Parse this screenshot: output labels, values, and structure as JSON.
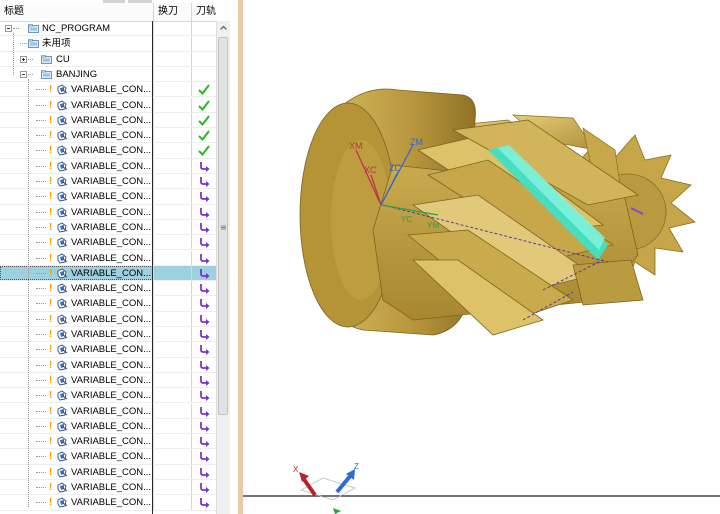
{
  "navigator": {
    "columns": {
      "name": "标题",
      "tool_change": "换刀",
      "toolpath": "刀轨"
    },
    "root": {
      "label": "NC_PROGRAM"
    },
    "unused": {
      "label": "未用项"
    },
    "groups": [
      {
        "label": "CU",
        "expanded": false
      },
      {
        "label": "BANJING",
        "expanded": true
      }
    ],
    "operations": [
      {
        "label": "VARIABLE_CON...",
        "status": "check"
      },
      {
        "label": "VARIABLE_CON...",
        "status": "check"
      },
      {
        "label": "VARIABLE_CON...",
        "status": "check"
      },
      {
        "label": "VARIABLE_CON...",
        "status": "check"
      },
      {
        "label": "VARIABLE_CON...",
        "status": "check"
      },
      {
        "label": "VARIABLE_CON...",
        "status": "regen"
      },
      {
        "label": "VARIABLE_CON...",
        "status": "regen"
      },
      {
        "label": "VARIABLE_CON...",
        "status": "regen"
      },
      {
        "label": "VARIABLE_CON...",
        "status": "regen"
      },
      {
        "label": "VARIABLE_CON...",
        "status": "regen"
      },
      {
        "label": "VARIABLE_CON...",
        "status": "regen"
      },
      {
        "label": "VARIABLE_CON...",
        "status": "regen"
      },
      {
        "label": "VARIABLE_CON...",
        "status": "regen",
        "selected": true
      },
      {
        "label": "VARIABLE_CON...",
        "status": "regen"
      },
      {
        "label": "VARIABLE_CON...",
        "status": "regen"
      },
      {
        "label": "VARIABLE_CON...",
        "status": "regen"
      },
      {
        "label": "VARIABLE_CON...",
        "status": "regen"
      },
      {
        "label": "VARIABLE_CON...",
        "status": "regen"
      },
      {
        "label": "VARIABLE_CON...",
        "status": "regen"
      },
      {
        "label": "VARIABLE_CON...",
        "status": "regen"
      },
      {
        "label": "VARIABLE_CON...",
        "status": "regen"
      },
      {
        "label": "VARIABLE_CON...",
        "status": "regen"
      },
      {
        "label": "VARIABLE_CON...",
        "status": "regen"
      },
      {
        "label": "VARIABLE_CON...",
        "status": "regen"
      },
      {
        "label": "VARIABLE_CON...",
        "status": "regen"
      },
      {
        "label": "VARIABLE_CON...",
        "status": "regen"
      },
      {
        "label": "VARIABLE_CON...",
        "status": "regen"
      },
      {
        "label": "VARIABLE_CON...",
        "status": "regen"
      }
    ]
  },
  "viewport": {
    "mcs_labels": {
      "xm": "XM",
      "xc": "XC",
      "zc": "ZC",
      "zm": "ZM",
      "yc": "YC",
      "ym": "YM"
    },
    "triad_labels": {
      "x": "X",
      "z": "Z"
    }
  },
  "colors": {
    "part": "#c8a84b",
    "toolpath": "#3ee0c4",
    "check": "#22bb22",
    "regen": "#7a33cc",
    "selection": "#9ed1e0",
    "splitter": "#e8c9a8"
  },
  "icons": {
    "check": "checkmark-icon",
    "regen": "regenerate-arrow-icon",
    "folder": "folder-icon",
    "operation": "operation-icon"
  }
}
